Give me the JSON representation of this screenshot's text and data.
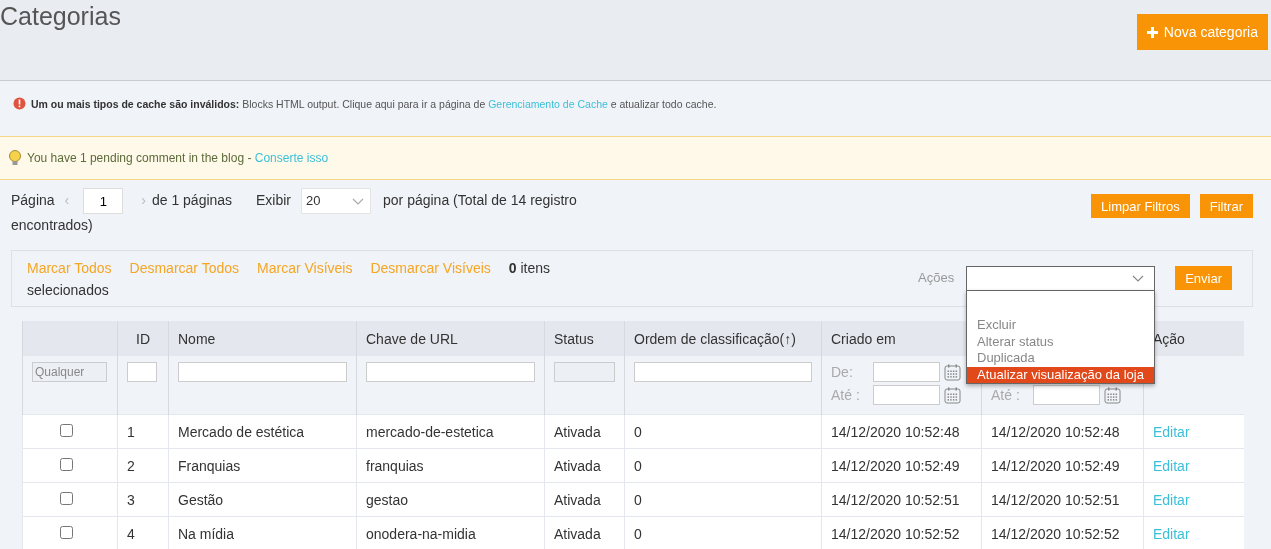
{
  "page_title": "Categorias",
  "new_button": {
    "label": "Nova categoria"
  },
  "cache_notice": {
    "bold": "Um ou mais tipos de cache são inválidos:",
    "text": "Blocks HTML output. Clique aqui para ir a página de",
    "link": "Gerenciamento de Cache",
    "after": "e atualizar todo cache."
  },
  "blog_notice": {
    "text": "You have 1 pending comment in the blog -",
    "link": "Conserte isso"
  },
  "pager": {
    "page_label": "Página",
    "prev": "‹",
    "page": "1",
    "next": "›",
    "of_pages": "de 1 páginas",
    "show_label": "Exibir",
    "per_page": "20",
    "summary": "por página (Total de 14 registro",
    "summary_end": "encontrados)"
  },
  "filter_buttons": [
    "Limpar Filtros",
    "Filtrar"
  ],
  "mass_actions": {
    "links": [
      "Marcar Todos",
      "Desmarcar Todos",
      "Marcar Visíveis",
      "Desmarcar Visíveis"
    ],
    "count": "0",
    "count_text": "itens",
    "count_text_end": "selecionados",
    "actions_label": "Ações",
    "submit": "Enviar",
    "options": [
      {
        "selected": false
      },
      {
        "label": "Excluir",
        "selected": false
      },
      {
        "label": "Alterar status",
        "selected": false
      },
      {
        "label": "Duplicada",
        "selected": false
      },
      {
        "label": "Atualizar visualização da loja",
        "selected": true
      }
    ]
  },
  "columns": [
    {
      "kind": "check",
      "filter_placeholder": "Qualquer"
    },
    {
      "kind": "text",
      "title": "ID"
    },
    {
      "kind": "text",
      "title": "Nome"
    },
    {
      "kind": "text",
      "title": "Chave de URL"
    },
    {
      "kind": "select",
      "title": "Status"
    },
    {
      "kind": "text",
      "title": "Ordem de classificação",
      "sort": "(↑)"
    },
    {
      "kind": "date",
      "title": "Criado em",
      "from": "De:",
      "to": "Até :"
    },
    {
      "kind": "date",
      "to": "Até :"
    },
    {
      "kind": "none",
      "title": "Ação"
    }
  ],
  "rows": [
    {
      "checked": false,
      "id": "1",
      "name": "Mercado de estética",
      "url_key": "mercado-de-estetica",
      "status": "Ativada",
      "sort_order": "0",
      "created": "14/12/2020 10:52:48",
      "updated": "14/12/2020 10:52:48",
      "action": "Editar"
    },
    {
      "checked": false,
      "id": "2",
      "name": "Franquias",
      "url_key": "franquias",
      "status": "Ativada",
      "sort_order": "0",
      "created": "14/12/2020 10:52:49",
      "updated": "14/12/2020 10:52:49",
      "action": "Editar"
    },
    {
      "checked": false,
      "id": "3",
      "name": "Gestão",
      "url_key": "gestao",
      "status": "Ativada",
      "sort_order": "0",
      "created": "14/12/2020 10:52:51",
      "updated": "14/12/2020 10:52:51",
      "action": "Editar"
    },
    {
      "checked": false,
      "id": "4",
      "name": "Na mídia",
      "url_key": "onodera-na-midia",
      "status": "Ativada",
      "sort_order": "0",
      "created": "14/12/2020 10:52:52",
      "updated": "14/12/2020 10:52:52",
      "action": "Editar"
    }
  ]
}
